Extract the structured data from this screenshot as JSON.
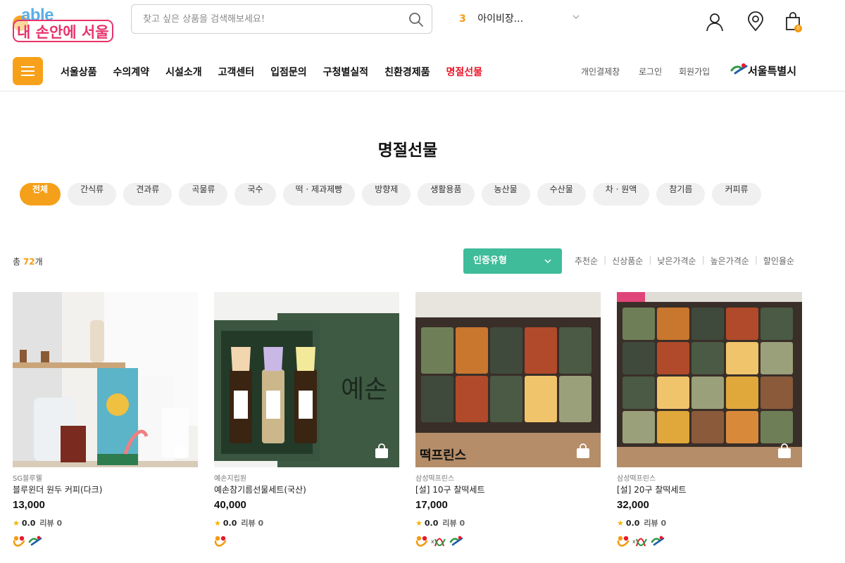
{
  "header": {
    "logo_en": "able",
    "logo_kr": "내 손안에 서울",
    "search_placeholder": "찾고 싶은 상품을 검색해보세요!",
    "ticker_rank": "3",
    "ticker_keyword": "아이비장...",
    "cart_count": "0"
  },
  "nav": {
    "items": [
      "서울상품",
      "수의계약",
      "시설소개",
      "고객센터",
      "입점문의",
      "구청별실적",
      "친환경제품",
      "명절선물"
    ],
    "active_index": 7,
    "util_links": [
      "개인결제창",
      "로그인",
      "회원가입"
    ],
    "seoul_logo_text": "서울특별시"
  },
  "page": {
    "title": "명절선물",
    "categories": [
      "전체",
      "간식류",
      "견과류",
      "곡물류",
      "국수",
      "떡 · 제과제빵",
      "방향제",
      "생활용품",
      "농산물",
      "수산물",
      "차 · 원액",
      "참기름",
      "커피류"
    ],
    "active_category": 0,
    "total_prefix": "총 ",
    "total_count": "72",
    "total_suffix": "개",
    "sort_select_value": "인증유형",
    "sort_options": [
      "추천순",
      "신상품순",
      "낮은가격순",
      "높은가격순",
      "할인율순"
    ]
  },
  "products": [
    {
      "vendor": "SG블루웰",
      "name": "블루윈더 원두 커피(다크)",
      "price": "13,000",
      "rating": "0.0",
      "review_label": "리뷰",
      "review_count": "0",
      "certs": [
        "social",
        "seoul"
      ]
    },
    {
      "vendor": "예손지립원",
      "name": "예손참기름선물세트(국산)",
      "price": "40,000",
      "rating": "0.0",
      "review_label": "리뷰",
      "review_count": "0",
      "certs": [
        "social"
      ]
    },
    {
      "vendor": "삼성떡프린스",
      "name": "[설] 10구 찰떡세트",
      "price": "17,000",
      "rating": "0.0",
      "review_label": "리뷰",
      "review_count": "0",
      "certs": [
        "social",
        "women",
        "seoul"
      ]
    },
    {
      "vendor": "삼성떡프린스",
      "name": "[설] 20구 찰떡세트",
      "price": "32,000",
      "rating": "0.0",
      "review_label": "리뷰",
      "review_count": "0",
      "certs": [
        "social",
        "women",
        "seoul"
      ]
    }
  ],
  "colors": {
    "accent": "#f5a01a",
    "active_nav": "#e8192c",
    "sort_select": "#3fbc9a",
    "count": "#f39c12"
  }
}
